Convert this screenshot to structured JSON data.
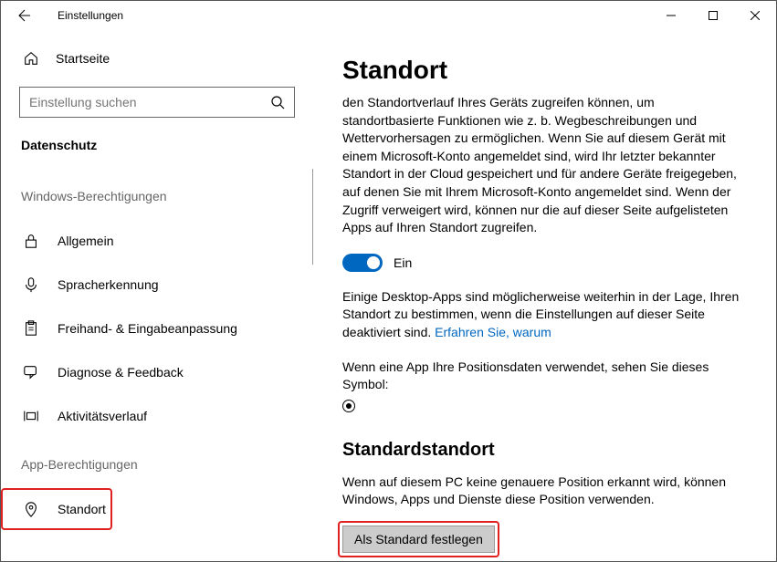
{
  "window_title": "Einstellungen",
  "search": {
    "placeholder": "Einstellung suchen"
  },
  "sidebar": {
    "home_label": "Startseite",
    "category": "Datenschutz",
    "section_windows": "Windows-Berechtigungen",
    "section_apps": "App-Berechtigungen",
    "items": {
      "allgemein": "Allgemein",
      "spracherkennung": "Spracherkennung",
      "freihand": "Freihand- & Eingabeanpassung",
      "diagnose": "Diagnose & Feedback",
      "aktivitaet": "Aktivitätsverlauf",
      "standort": "Standort"
    }
  },
  "main": {
    "heading": "Standort",
    "paragraph1": "den Standortverlauf Ihres Geräts zugreifen können, um standortbasierte Funktionen wie z. b. Wegbeschreibungen und Wettervorhersagen zu ermöglichen. Wenn Sie auf diesem Gerät mit einem Microsoft-Konto angemeldet sind, wird Ihr letzter bekannter Standort in der Cloud gespeichert und für andere Geräte freigegeben, auf denen Sie mit Ihrem Microsoft-Konto angemeldet sind. Wenn der Zugriff verweigert wird, können nur die auf dieser Seite aufgelisteten Apps auf Ihren Standort zugreifen.",
    "toggle_label": "Ein",
    "paragraph2_a": "Einige Desktop-Apps sind möglicherweise weiterhin in der Lage, Ihren Standort zu bestimmen, wenn die Einstellungen auf dieser Seite deaktiviert sind. ",
    "paragraph2_link": "Erfahren Sie, warum",
    "symbol_text": "Wenn eine App Ihre Positionsdaten verwendet, sehen Sie dieses Symbol:",
    "subheading": "Standardstandort",
    "paragraph3": "Wenn auf diesem PC keine genauere Position erkannt wird, können Windows, Apps und Dienste diese Position verwenden.",
    "button_label": "Als Standard festlegen"
  }
}
